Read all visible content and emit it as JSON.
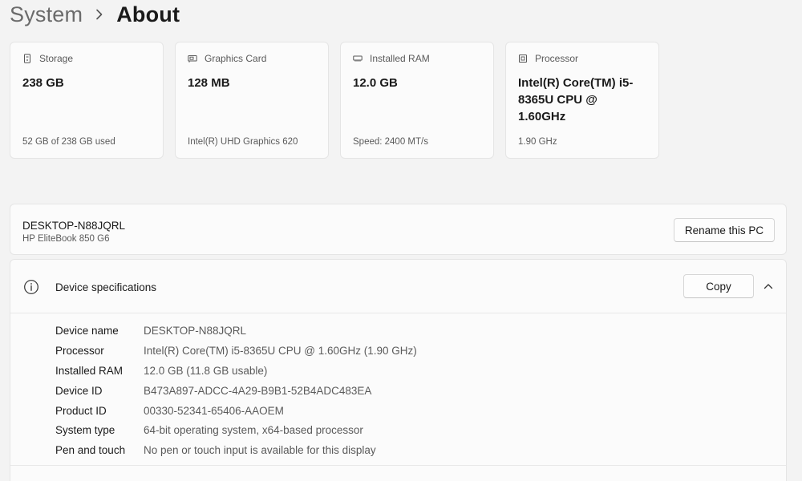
{
  "breadcrumb": {
    "parent": "System",
    "current": "About"
  },
  "cards": [
    {
      "title": "Storage",
      "icon": "storage-icon",
      "value": "238 GB",
      "footer": "52 GB of 238 GB used"
    },
    {
      "title": "Graphics Card",
      "icon": "graphics-card-icon",
      "value": "128 MB",
      "footer": "Intel(R) UHD Graphics 620"
    },
    {
      "title": "Installed RAM",
      "icon": "ram-icon",
      "value": "12.0 GB",
      "footer": "Speed: 2400 MT/s"
    },
    {
      "title": "Processor",
      "icon": "processor-icon",
      "value": "Intel(R) Core(TM) i5-8365U CPU @ 1.60GHz",
      "footer": "1.90 GHz"
    }
  ],
  "pc": {
    "name": "DESKTOP-N88JQRL",
    "model": "HP EliteBook 850 G6",
    "rename_label": "Rename this PC"
  },
  "specs": {
    "title": "Device specifications",
    "copy_label": "Copy",
    "rows": [
      {
        "label": "Device name",
        "value": "DESKTOP-N88JQRL"
      },
      {
        "label": "Processor",
        "value": "Intel(R) Core(TM) i5-8365U CPU @ 1.60GHz (1.90 GHz)"
      },
      {
        "label": "Installed RAM",
        "value": "12.0 GB (11.8 GB usable)"
      },
      {
        "label": "Device ID",
        "value": "B473A897-ADCC-4A29-B9B1-52B4ADC483EA"
      },
      {
        "label": "Product ID",
        "value": "00330-52341-65406-AAOEM"
      },
      {
        "label": "System type",
        "value": "64-bit operating system, x64-based processor"
      },
      {
        "label": "Pen and touch",
        "value": "No pen or touch input is available for this display"
      }
    ]
  }
}
